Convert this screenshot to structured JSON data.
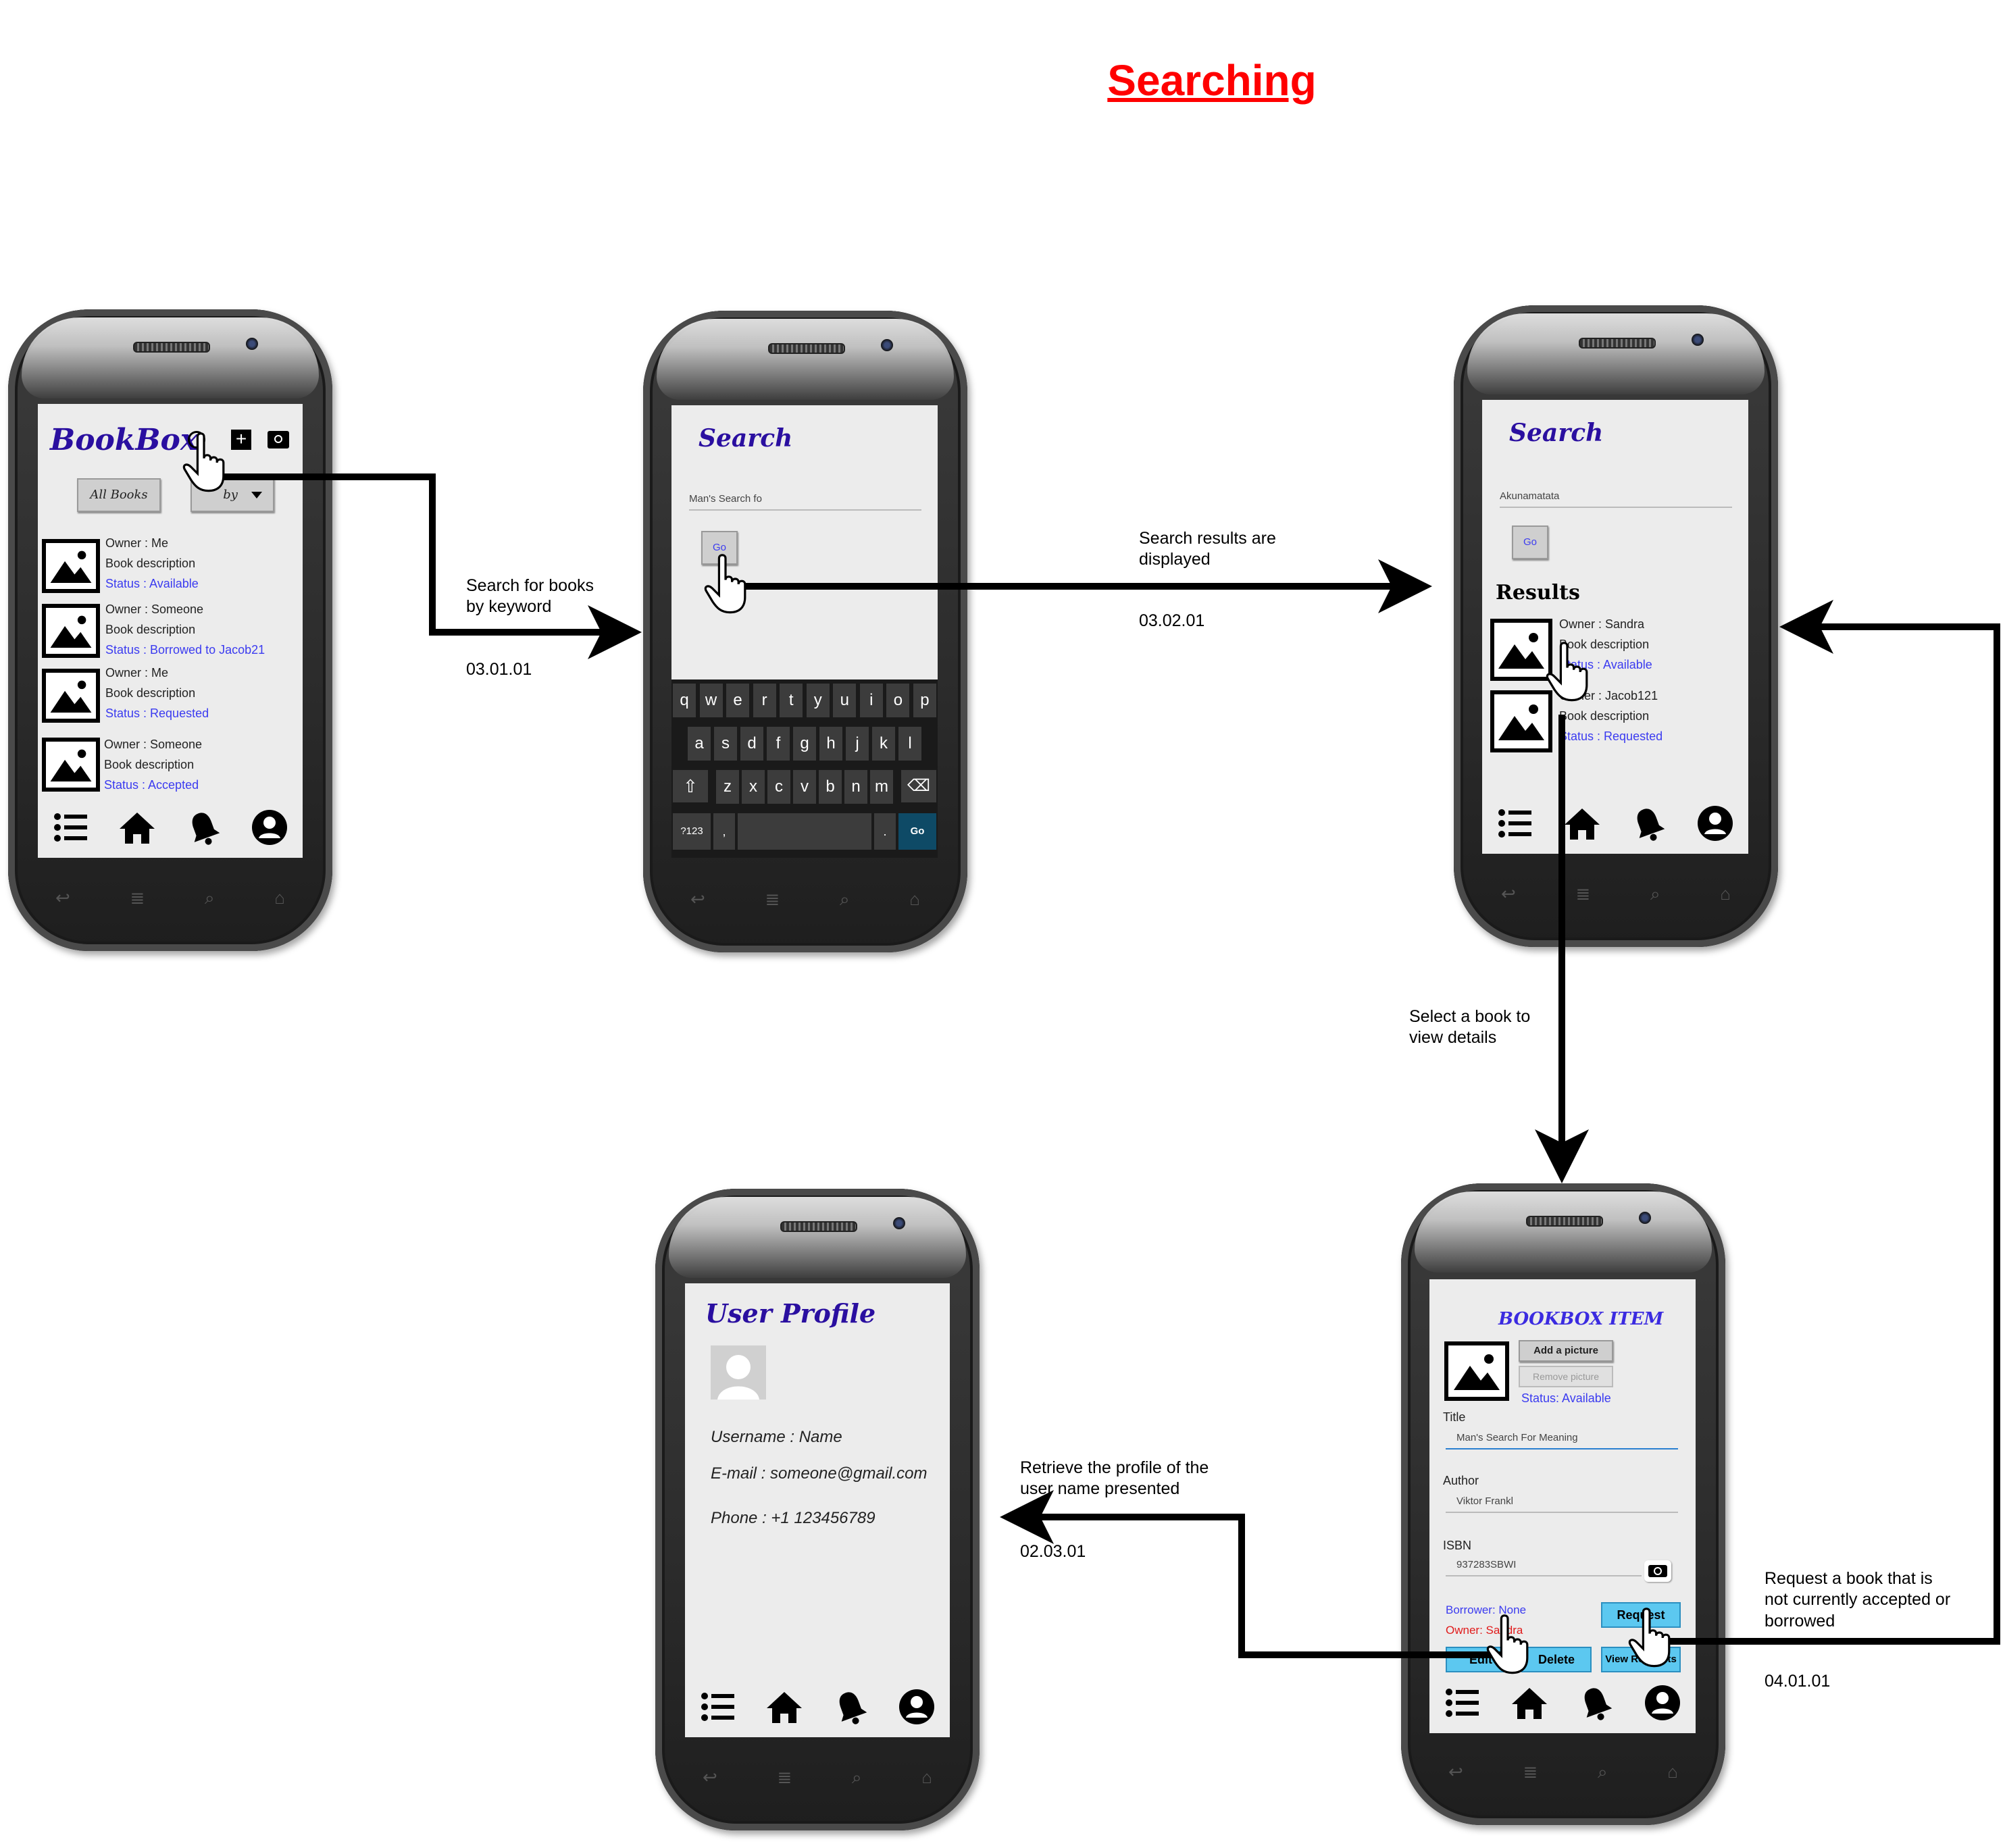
{
  "page_title": "Searching",
  "screens": {
    "home": {
      "app_title": "BookBox",
      "all_books_button": "All Books",
      "sort_button": "by",
      "books": [
        {
          "owner": "Owner : Me",
          "description": "Book description",
          "status": "Status : Available"
        },
        {
          "owner": "Owner : Someone",
          "description": "Book description",
          "status": "Status : Borrowed to Jacob21"
        },
        {
          "owner": "Owner : Me",
          "description": "Book description",
          "status": "Status : Requested"
        },
        {
          "owner": "Owner : Someone",
          "description": "Book description",
          "status": "Status : Accepted"
        }
      ]
    },
    "search": {
      "title": "Search",
      "input_value": "Man's Search fo",
      "go_button": "Go",
      "keyboard": {
        "row1": [
          "q",
          "w",
          "e",
          "r",
          "t",
          "y",
          "u",
          "i",
          "o",
          "p"
        ],
        "row2": [
          "a",
          "s",
          "d",
          "f",
          "g",
          "h",
          "j",
          "k",
          "l"
        ],
        "row3": [
          "z",
          "x",
          "c",
          "v",
          "b",
          "n",
          "m"
        ],
        "symbols_key": "?123",
        "comma_key": ",",
        "period_key": ".",
        "go_key": "Go"
      }
    },
    "results": {
      "title": "Search",
      "input_value": "Akunamatata",
      "go_button": "Go",
      "results_heading": "Results",
      "books": [
        {
          "owner": "Owner : Sandra",
          "description": "Book description",
          "status": "Status : Available"
        },
        {
          "owner": "Owner : Jacob121",
          "description": "Book description",
          "status": "Status : Requested"
        }
      ]
    },
    "item": {
      "title": "BOOKBOX ITEM",
      "add_picture": "Add a picture",
      "remove_picture": "Remove picture",
      "status": "Status: Available",
      "title_label": "Title",
      "title_value": "Man's Search For Meaning",
      "author_label": "Author",
      "author_value": "Viktor Frankl",
      "isbn_label": "ISBN",
      "isbn_value": "937283SBWI",
      "borrower": "Borrower: None",
      "owner": "Owner: Sandra",
      "request_button": "Request",
      "edit_button": "Edit",
      "delete_button": "Delete",
      "view_button": "View Requests"
    },
    "profile": {
      "title": "User Profile",
      "username": "Username : Name",
      "email": "E-mail : someone@gmail.com",
      "phone": "Phone : +1 123456789"
    }
  },
  "annotations": [
    {
      "text": "Search for books\nby keyword",
      "code": "03.01.01"
    },
    {
      "text": "Search results are\ndisplayed",
      "code": "03.02.01"
    },
    {
      "text": "Select a book to\nview details",
      "code": ""
    },
    {
      "text": "Retrieve the profile of the\nuser name presented",
      "code": "02.03.01"
    },
    {
      "text": "Request a book that is\nnot currently accepted or\nborrowed",
      "code": "04.01.01"
    }
  ],
  "colors": {
    "title_red": "#ff0000",
    "app_title_purple": "#2a0fa0",
    "status_blue": "#3b3bf0",
    "owner_red": "#e01b1b",
    "button_blue": "#5cc8f0"
  }
}
